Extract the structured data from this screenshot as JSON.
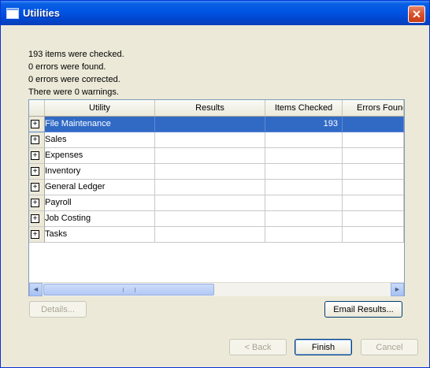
{
  "window": {
    "title": "Utilities",
    "close_glyph": "✕"
  },
  "status_lines": [
    "193 items were checked.",
    "0 errors were found.",
    "0 errors were corrected.",
    "There were 0 warnings."
  ],
  "grid": {
    "columns": [
      "Utility",
      "Results",
      "Items Checked",
      "Errors Found"
    ],
    "rows": [
      {
        "utility": "File Maintenance",
        "results": "",
        "items_checked": "193",
        "errors_found": ""
      },
      {
        "utility": "Sales",
        "results": "",
        "items_checked": "",
        "errors_found": ""
      },
      {
        "utility": "Expenses",
        "results": "",
        "items_checked": "",
        "errors_found": ""
      },
      {
        "utility": "Inventory",
        "results": "",
        "items_checked": "",
        "errors_found": ""
      },
      {
        "utility": "General Ledger",
        "results": "",
        "items_checked": "",
        "errors_found": ""
      },
      {
        "utility": "Payroll",
        "results": "",
        "items_checked": "",
        "errors_found": ""
      },
      {
        "utility": "Job Costing",
        "results": "",
        "items_checked": "",
        "errors_found": ""
      },
      {
        "utility": "Tasks",
        "results": "",
        "items_checked": "",
        "errors_found": ""
      }
    ],
    "expand_glyph": "+",
    "scroll_left_glyph": "◄",
    "scroll_right_glyph": "►"
  },
  "buttons": {
    "details": "Details...",
    "email_results": "Email Results...",
    "back": "< Back",
    "finish": "Finish",
    "cancel": "Cancel"
  }
}
